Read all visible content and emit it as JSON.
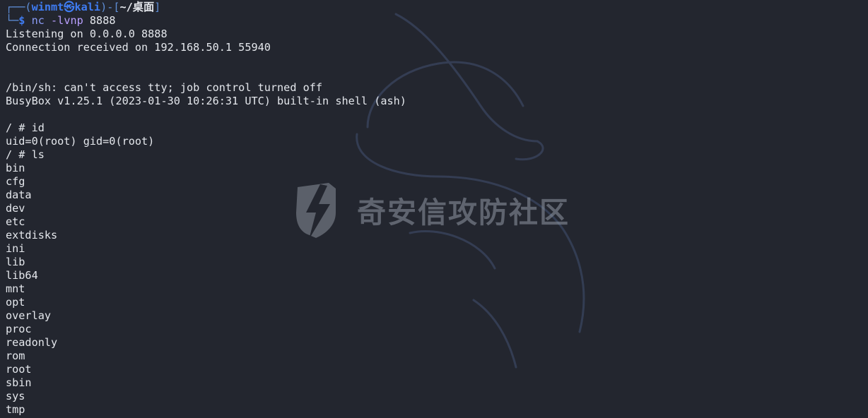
{
  "prompt": {
    "open_bracket": "┌──(",
    "user": "winmt",
    "host_sep": "㉿",
    "host": "kali",
    "mid": ")-[",
    "path": "~/桌面",
    "close": "]",
    "second_prefix": "└─",
    "dollar": "$ "
  },
  "command": {
    "name": "nc",
    "flags": " -lvnp",
    "port": " 8888"
  },
  "output": {
    "listening": "Listening on 0.0.0.0 8888",
    "connection": "Connection received on 192.168.50.1 55940",
    "tty_msg": "/bin/sh: can't access tty; job control turned off",
    "busybox": "BusyBox v1.25.1 (2023-01-30 10:26:31 UTC) built-in shell (ash)",
    "prompt_id": "/ # id",
    "id_result": "uid=0(root) gid=0(root)",
    "prompt_ls": "/ # ls",
    "ls_entries": [
      "bin",
      "cfg",
      "data",
      "dev",
      "etc",
      "extdisks",
      "ini",
      "lib",
      "lib64",
      "mnt",
      "opt",
      "overlay",
      "proc",
      "readonly",
      "rom",
      "root",
      "sbin",
      "sys",
      "tmp"
    ]
  },
  "watermark": {
    "text": "奇安信攻防社区",
    "logo_icon": "lightning-shield-icon"
  },
  "colors": {
    "background": "#23262f",
    "foreground": "#e4e7ec",
    "prompt_blue": "#3f7cf2",
    "command": "#8b9cf6"
  }
}
